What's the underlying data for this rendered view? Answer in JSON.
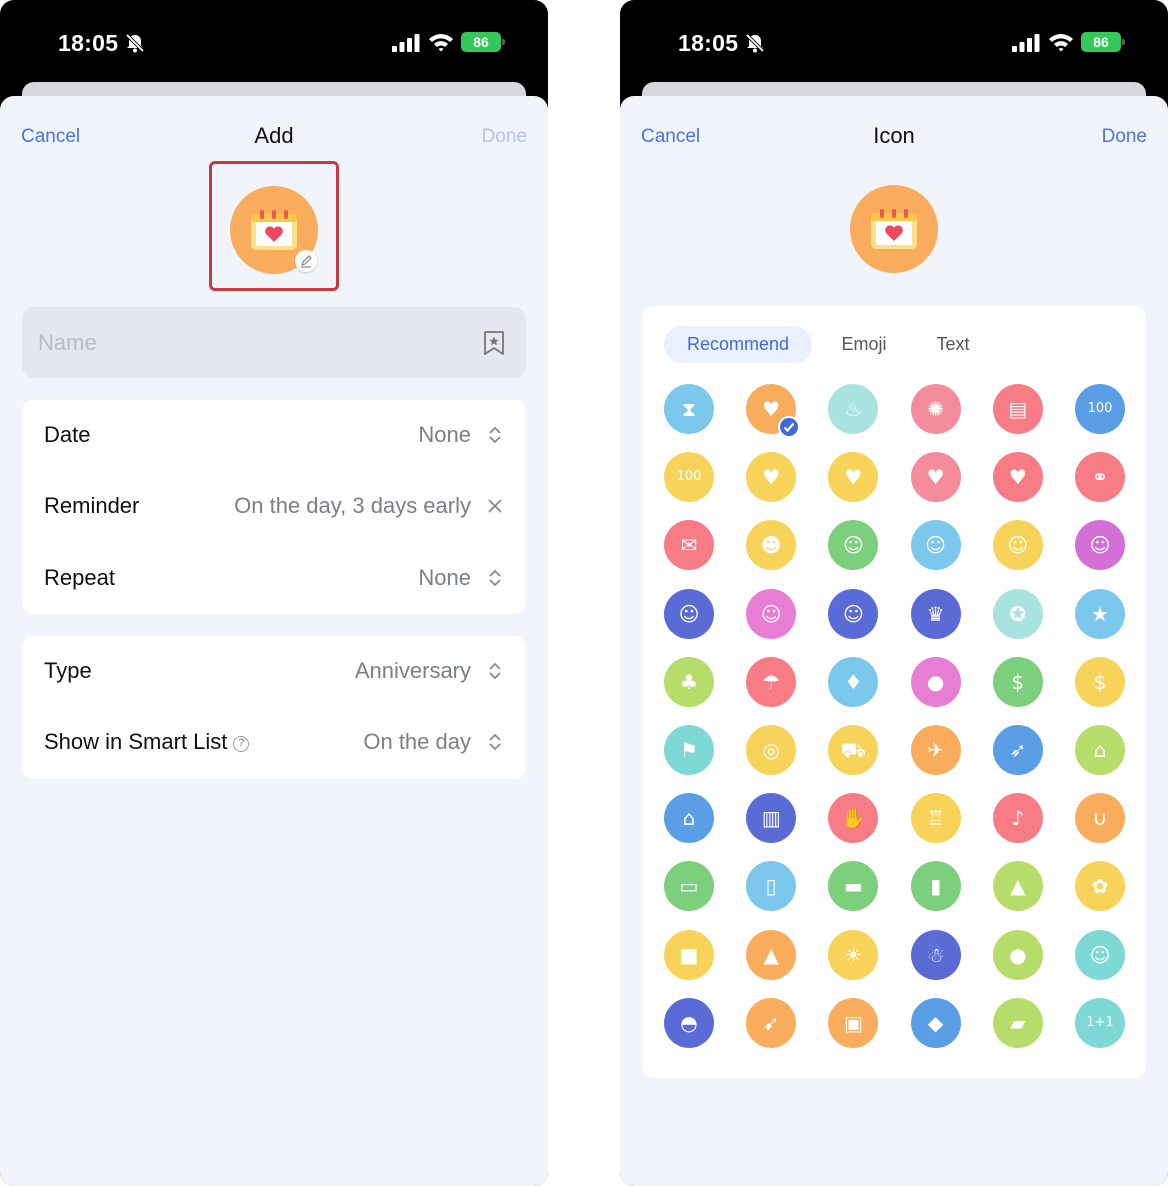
{
  "left_screen": {
    "status": {
      "time": "18:05",
      "battery": "86"
    },
    "nav": {
      "cancel": "Cancel",
      "title": "Add",
      "done": "Done"
    },
    "name_placeholder": "Name",
    "rows": {
      "date": {
        "label": "Date",
        "value": "None"
      },
      "reminder": {
        "label": "Reminder",
        "value": "On the day, 3 days early"
      },
      "repeat": {
        "label": "Repeat",
        "value": "None"
      },
      "type": {
        "label": "Type",
        "value": "Anniversary"
      },
      "smart_list": {
        "label": "Show in Smart List",
        "value": "On the day"
      }
    }
  },
  "right_screen": {
    "status": {
      "time": "18:05",
      "battery": "86"
    },
    "nav": {
      "cancel": "Cancel",
      "title": "Icon",
      "done": "Done"
    },
    "tabs": [
      "Recommend",
      "Emoji",
      "Text"
    ],
    "active_tab": "Recommend",
    "icons": [
      {
        "name": "hourglass-icon",
        "bg": "#7cc7ec",
        "glyph": "⧗"
      },
      {
        "name": "calendar-heart-icon",
        "bg": "#f9ac5c",
        "glyph": "♥",
        "selected": true
      },
      {
        "name": "cake-icon",
        "bg": "#a8e3df",
        "glyph": "♨"
      },
      {
        "name": "fireworks-icon",
        "bg": "#f58c9c",
        "glyph": "✺"
      },
      {
        "name": "calendar-icon",
        "bg": "#f77c85",
        "glyph": "▤"
      },
      {
        "name": "calendar-100-icon",
        "bg": "#5a9ee6",
        "glyph": "100"
      },
      {
        "name": "score-100-icon",
        "bg": "#f7d35a",
        "glyph": "100"
      },
      {
        "name": "heart-icon",
        "bg": "#f7d35a",
        "glyph": "♥"
      },
      {
        "name": "two-hearts-icon",
        "bg": "#f7d35a",
        "glyph": "♥"
      },
      {
        "name": "love-birds-icon",
        "bg": "#f58c9c",
        "glyph": "♥"
      },
      {
        "name": "hands-heart-icon",
        "bg": "#f77c85",
        "glyph": "♥"
      },
      {
        "name": "rings-icon",
        "bg": "#f77c85",
        "glyph": "⚭"
      },
      {
        "name": "love-letter-icon",
        "bg": "#f77c85",
        "glyph": "✉"
      },
      {
        "name": "paw-icon",
        "bg": "#f7d35a",
        "glyph": "☻"
      },
      {
        "name": "girl-face-icon",
        "bg": "#7ccf7c",
        "glyph": "☺"
      },
      {
        "name": "boy-face-icon",
        "bg": "#7cc7ec",
        "glyph": "☺"
      },
      {
        "name": "woman-face-icon",
        "bg": "#f7d35a",
        "glyph": "☺"
      },
      {
        "name": "lady-face-icon",
        "bg": "#d36fd6",
        "glyph": "☺"
      },
      {
        "name": "man-face-icon",
        "bg": "#5b6bd6",
        "glyph": "☺"
      },
      {
        "name": "grandma-icon",
        "bg": "#e87dd4",
        "glyph": "☺"
      },
      {
        "name": "grandpa-icon",
        "bg": "#5b6bd6",
        "glyph": "☺"
      },
      {
        "name": "trophy-icon",
        "bg": "#5b6bd6",
        "glyph": "♛"
      },
      {
        "name": "medal-icon",
        "bg": "#a8e3df",
        "glyph": "✪"
      },
      {
        "name": "star-icon",
        "bg": "#7cc7ec",
        "glyph": "★"
      },
      {
        "name": "palm-tree-icon",
        "bg": "#b6dd6a",
        "glyph": "♣"
      },
      {
        "name": "beach-umbrella-icon",
        "bg": "#f77c85",
        "glyph": "☂"
      },
      {
        "name": "cheers-icon",
        "bg": "#7cc7ec",
        "glyph": "♦"
      },
      {
        "name": "balloons-icon",
        "bg": "#e87dd4",
        "glyph": "●"
      },
      {
        "name": "money-bag-icon",
        "bg": "#7ccf7c",
        "glyph": "$"
      },
      {
        "name": "cash-icon",
        "bg": "#f7d35a",
        "glyph": "$"
      },
      {
        "name": "flag-icon",
        "bg": "#7ed9d6",
        "glyph": "⚑"
      },
      {
        "name": "target-icon",
        "bg": "#f7d35a",
        "glyph": "◎"
      },
      {
        "name": "car-icon",
        "bg": "#f7d35a",
        "glyph": "⛟"
      },
      {
        "name": "airplane-icon",
        "bg": "#f9ac5c",
        "glyph": "✈"
      },
      {
        "name": "rocket-icon",
        "bg": "#5a9ee6",
        "glyph": "➶"
      },
      {
        "name": "school-icon",
        "bg": "#b6dd6a",
        "glyph": "⌂"
      },
      {
        "name": "house-icon",
        "bg": "#5a9ee6",
        "glyph": "⌂"
      },
      {
        "name": "office-building-icon",
        "bg": "#5b6bd6",
        "glyph": "▥"
      },
      {
        "name": "handshake-icon",
        "bg": "#f77c85",
        "glyph": "✋"
      },
      {
        "name": "podium-icon",
        "bg": "#f7d35a",
        "glyph": "♖"
      },
      {
        "name": "microphone-icon",
        "bg": "#f77c85",
        "glyph": "♪"
      },
      {
        "name": "stethoscope-icon",
        "bg": "#f9ac5c",
        "glyph": "∪"
      },
      {
        "name": "id-card-icon",
        "bg": "#7ccf7c",
        "glyph": "▭"
      },
      {
        "name": "passport-icon",
        "bg": "#7cc7ec",
        "glyph": "▯"
      },
      {
        "name": "credit-card-icon",
        "bg": "#7ccf7c",
        "glyph": "▬"
      },
      {
        "name": "luggage-icon",
        "bg": "#7ccf7c",
        "glyph": "▮"
      },
      {
        "name": "christmas-tree-icon",
        "bg": "#b6dd6a",
        "glyph": "▲"
      },
      {
        "name": "rose-icon",
        "bg": "#f7d35a",
        "glyph": "✿"
      },
      {
        "name": "gift-icon",
        "bg": "#f7d35a",
        "glyph": "■"
      },
      {
        "name": "mountain-icon",
        "bg": "#f9ac5c",
        "glyph": "▲"
      },
      {
        "name": "sun-icon",
        "bg": "#f7d35a",
        "glyph": "☀"
      },
      {
        "name": "snowman-icon",
        "bg": "#5b6bd6",
        "glyph": "☃"
      },
      {
        "name": "pumpkin-icon",
        "bg": "#b6dd6a",
        "glyph": "●"
      },
      {
        "name": "clown-icon",
        "bg": "#7ed9d6",
        "glyph": "☺"
      },
      {
        "name": "turkey-icon",
        "bg": "#5b6bd6",
        "glyph": "◓"
      },
      {
        "name": "runner-icon",
        "bg": "#f9ac5c",
        "glyph": "➹"
      },
      {
        "name": "backpack-icon",
        "bg": "#f9ac5c",
        "glyph": "▣"
      },
      {
        "name": "graduation-cap-icon",
        "bg": "#5a9ee6",
        "glyph": "◆"
      },
      {
        "name": "briefcase-icon",
        "bg": "#b6dd6a",
        "glyph": "▰"
      },
      {
        "name": "blackboard-icon",
        "bg": "#7ed9d6",
        "glyph": "1+1"
      }
    ]
  },
  "colors": {
    "accent": "#4a72e0",
    "done_disabled": "#b3c2ee",
    "highlight": "#c8383d",
    "sheet": "#f2f4fc",
    "battery": "#34c759"
  }
}
